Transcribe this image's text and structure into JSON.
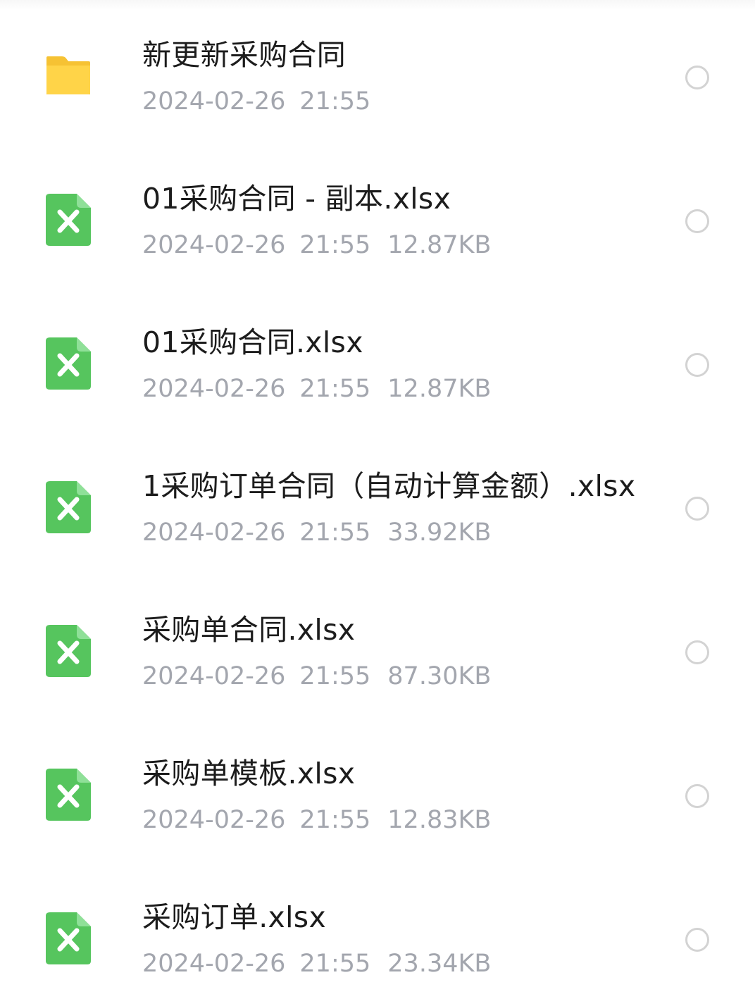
{
  "colors": {
    "folder": "#ffd448",
    "excel_icon": "#56c55e",
    "name_text": "#1c1c1c",
    "meta_text": "#a3a6ae",
    "radio_border": "#d3d3d3"
  },
  "files": [
    {
      "type": "folder",
      "icon": "folder-icon",
      "name": "新更新采购合同",
      "date": "2024-02-26",
      "time": "21:55",
      "size": ""
    },
    {
      "type": "xlsx",
      "icon": "excel-file-icon",
      "name": "01采购合同 - 副本.xlsx",
      "date": "2024-02-26",
      "time": "21:55",
      "size": "12.87KB"
    },
    {
      "type": "xlsx",
      "icon": "excel-file-icon",
      "name": "01采购合同.xlsx",
      "date": "2024-02-26",
      "time": "21:55",
      "size": "12.87KB"
    },
    {
      "type": "xlsx",
      "icon": "excel-file-icon",
      "name": "1采购订单合同（自动计算金额）.xlsx",
      "date": "2024-02-26",
      "time": "21:55",
      "size": "33.92KB"
    },
    {
      "type": "xlsx",
      "icon": "excel-file-icon",
      "name": "采购单合同.xlsx",
      "date": "2024-02-26",
      "time": "21:55",
      "size": "87.30KB"
    },
    {
      "type": "xlsx",
      "icon": "excel-file-icon",
      "name": "采购单模板.xlsx",
      "date": "2024-02-26",
      "time": "21:55",
      "size": "12.83KB"
    },
    {
      "type": "xlsx",
      "icon": "excel-file-icon",
      "name": "采购订单.xlsx",
      "date": "2024-02-26",
      "time": "21:55",
      "size": "23.34KB"
    }
  ]
}
